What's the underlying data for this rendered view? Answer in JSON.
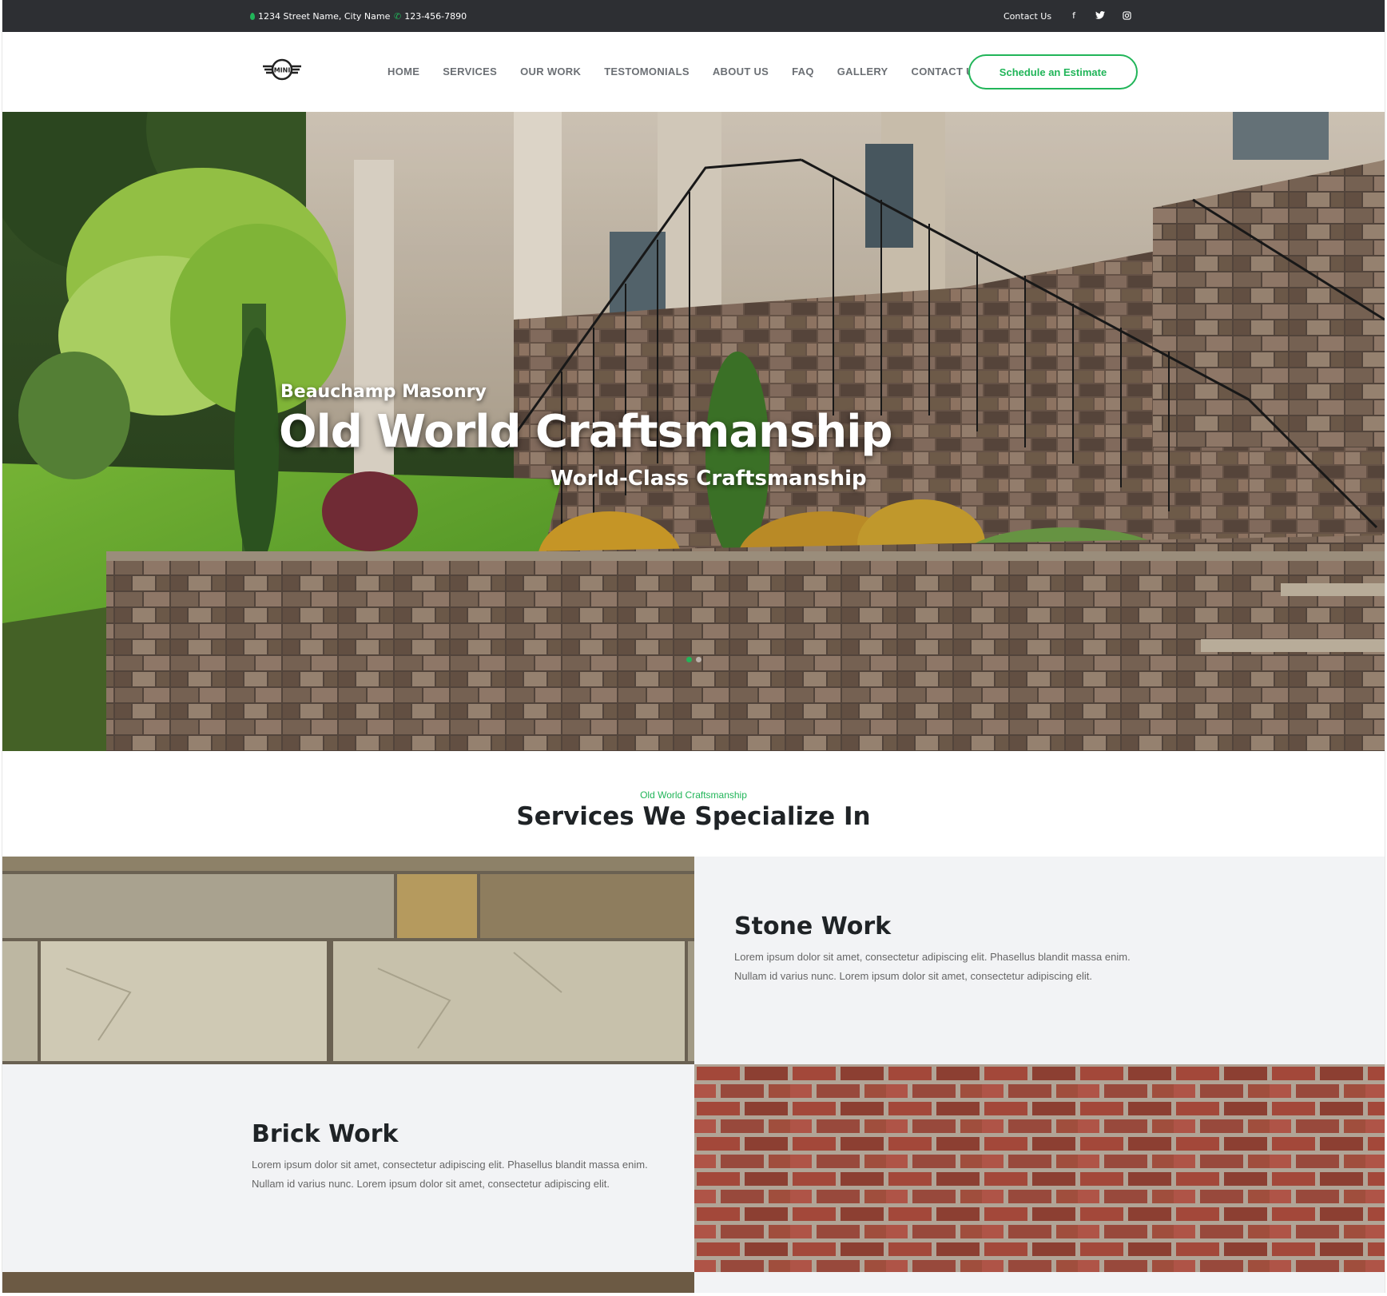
{
  "topbar": {
    "address": "1234 Street Name, City Name",
    "phone": "123-456-7890",
    "contact_link": "Contact Us",
    "social": [
      {
        "icon": "facebook-icon",
        "glyph": "f"
      },
      {
        "icon": "twitter-icon",
        "glyph": "t"
      },
      {
        "icon": "instagram-icon",
        "glyph": "◎"
      }
    ]
  },
  "nav": {
    "logo_text": "MINI",
    "items": [
      "HOME",
      "SERVICES",
      "OUR WORK",
      "TESTOMONIALS",
      "ABOUT US",
      "FAQ",
      "GALLERY",
      "CONTACT US"
    ],
    "cta": "Schedule an Estimate"
  },
  "hero": {
    "eyebrow": "Beauchamp Masonry",
    "title": "Old World Craftsmanship",
    "subtitle": "World-Class Craftsmanship",
    "slides": 2,
    "active_slide": 1
  },
  "services_section": {
    "eyebrow": "Old World Craftsmanship",
    "title": "Services We Specialize In",
    "items": [
      {
        "title": "Stone Work",
        "description": "Lorem ipsum dolor sit amet, consectetur adipiscing elit. Phasellus blandit massa enim. Nullam id varius nunc. Lorem ipsum dolor sit amet, consectetur adipiscing elit."
      },
      {
        "title": "Brick Work",
        "description": "Lorem ipsum dolor sit amet, consectetur adipiscing elit. Phasellus blandit massa enim. Nullam id varius nunc. Lorem ipsum dolor sit amet, consectetur adipiscing elit."
      }
    ]
  },
  "colors": {
    "accent": "#21b559",
    "topbar_bg": "#2d2f33",
    "panel_bg": "#f2f3f5",
    "heading": "#1f2326",
    "nav_text": "#6b6f74"
  }
}
